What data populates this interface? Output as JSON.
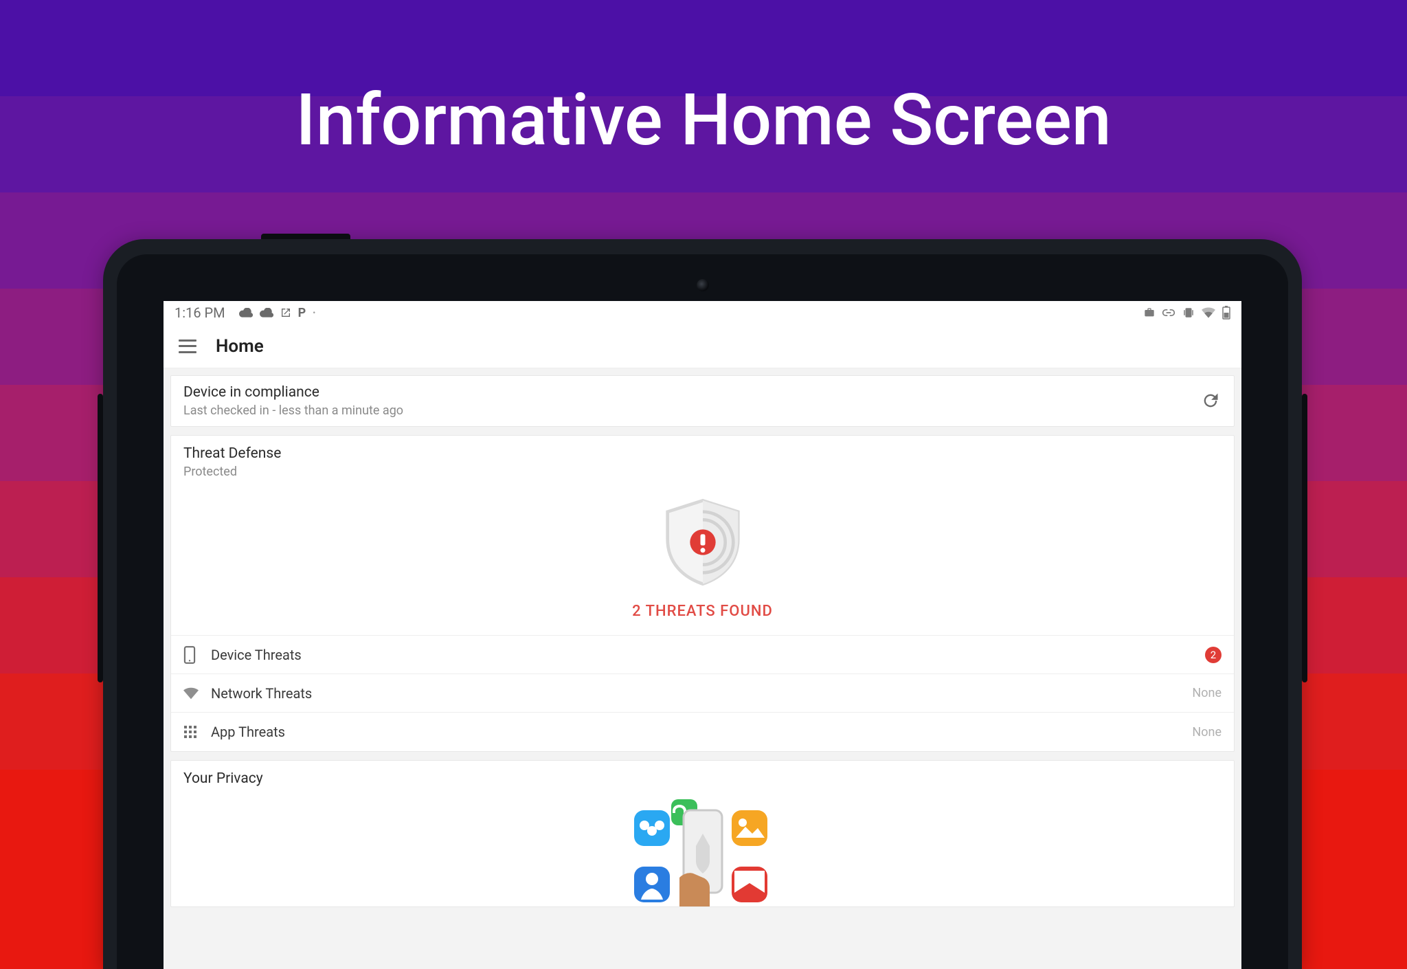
{
  "page_title": "Informative Home Screen",
  "status_bar": {
    "time": "1:16 PM"
  },
  "app_bar": {
    "title": "Home"
  },
  "compliance_card": {
    "title": "Device in compliance",
    "subtitle": "Last checked in - less than a minute ago"
  },
  "threat_defense": {
    "title": "Threat Defense",
    "status": "Protected",
    "banner": "2 THREATS FOUND",
    "rows": [
      {
        "icon": "device",
        "label": "Device Threats",
        "value_type": "badge",
        "value": "2"
      },
      {
        "icon": "wifi",
        "label": "Network Threats",
        "value_type": "text",
        "value": "None"
      },
      {
        "icon": "apps",
        "label": "App Threats",
        "value_type": "text",
        "value": "None"
      }
    ]
  },
  "privacy_card": {
    "title": "Your Privacy"
  },
  "colors": {
    "threat_red": "#e14b45",
    "badge_red": "#e03c36"
  }
}
